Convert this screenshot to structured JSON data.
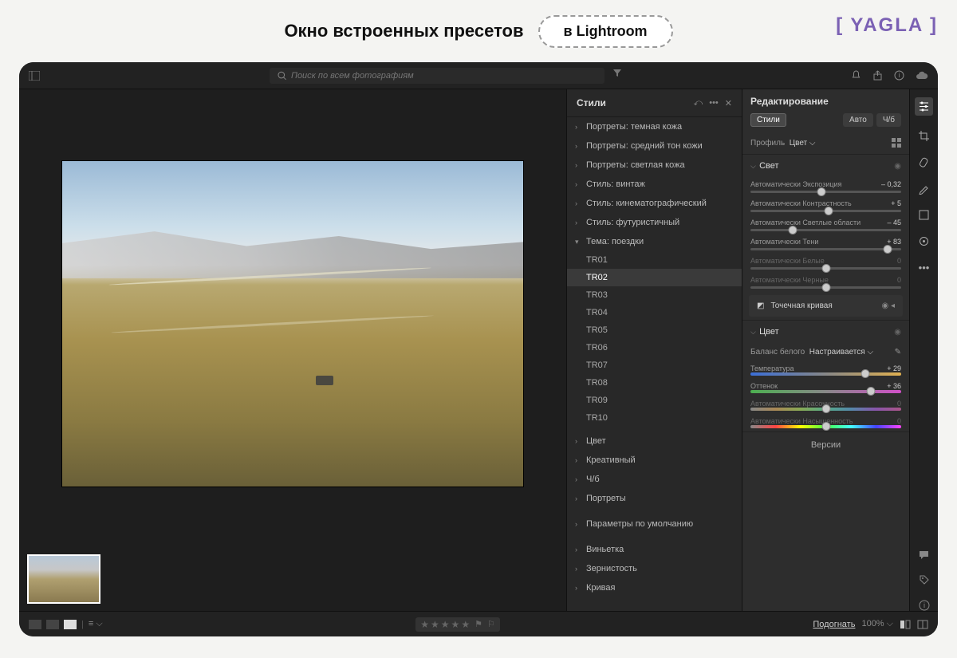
{
  "banner": {
    "title": "Окно встроенных пресетов",
    "pill": "в Lightroom",
    "logo": "YAGLA"
  },
  "topbar": {
    "search_placeholder": "Поиск по всем фотографиям"
  },
  "presets": {
    "panel_title": "Стили",
    "groups_top": [
      "Портреты: темная кожа",
      "Портреты: средний тон кожи",
      "Портреты: светлая кожа",
      "Стиль: винтаж",
      "Стиль: кинематографический",
      "Стиль: футуристичный"
    ],
    "expanded_group": "Тема: поездки",
    "items": [
      "TR01",
      "TR02",
      "TR03",
      "TR04",
      "TR05",
      "TR06",
      "TR07",
      "TR08",
      "TR09",
      "TR10"
    ],
    "selected": "TR02",
    "groups_mid": [
      "Цвет",
      "Креативный",
      "Ч/б",
      "Портреты"
    ],
    "defaults": "Параметры по умолчанию",
    "groups_bottom": [
      "Виньетка",
      "Зернистость",
      "Кривая"
    ]
  },
  "edit": {
    "title": "Редактирование",
    "tab_styles": "Стили",
    "tab_auto": "Авто",
    "tab_bw": "Ч/б",
    "profile_label": "Профиль",
    "profile_value": "Цвет",
    "light_section": "Свет",
    "light_sliders": [
      {
        "label": "Автоматически Экспозиция",
        "value": "– 0,32",
        "pos": 47
      },
      {
        "label": "Автоматически Контрастность",
        "value": "+ 5",
        "pos": 52
      },
      {
        "label": "Автоматически Светлые области",
        "value": "– 45",
        "pos": 28
      },
      {
        "label": "Автоматически Тени",
        "value": "+ 83",
        "pos": 91
      },
      {
        "label": "Автоматически Белые",
        "value": "0",
        "pos": 50,
        "dim": true
      },
      {
        "label": "Автоматически Черные",
        "value": "0",
        "pos": 50,
        "dim": true
      }
    ],
    "curve_label": "Точечная кривая",
    "color_section": "Цвет",
    "wb_label": "Баланс белого",
    "wb_value": "Настраивается",
    "color_sliders": [
      {
        "label": "Температура",
        "value": "+ 29",
        "pos": 76,
        "track": "temp"
      },
      {
        "label": "Оттенок",
        "value": "+ 36",
        "pos": 80,
        "track": "tint"
      },
      {
        "label": "Автоматически Красочность",
        "value": "0",
        "pos": 50,
        "dim": true,
        "track": "vib"
      },
      {
        "label": "Автоматически Насыщенность",
        "value": "0",
        "pos": 50,
        "dim": true,
        "track": "sat"
      }
    ],
    "versions": "Версии"
  },
  "bottombar": {
    "fit": "Подогнать",
    "zoom": "100%"
  }
}
